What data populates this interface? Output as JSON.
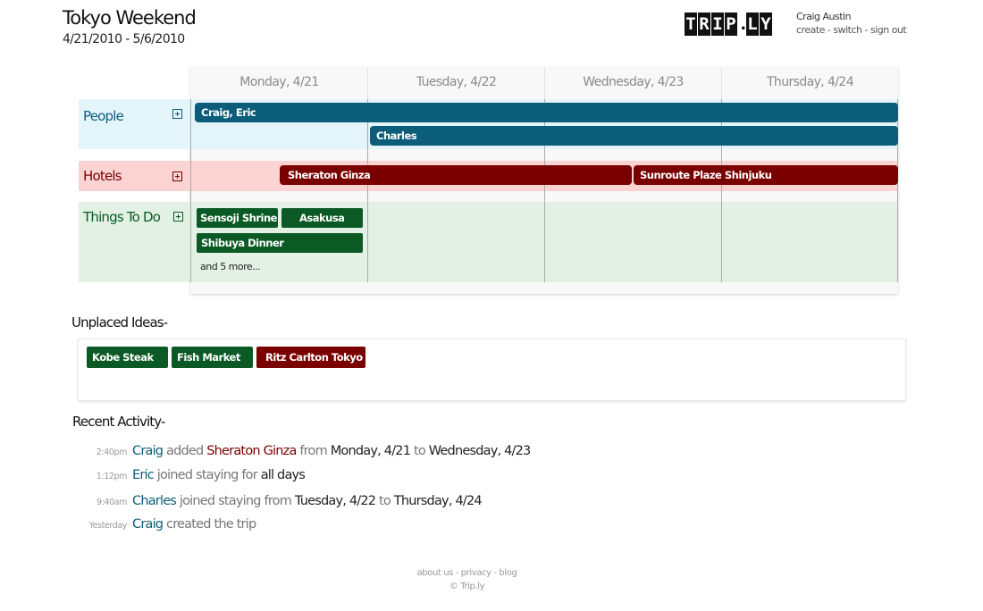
{
  "trip": {
    "title": "Tokyo Weekend",
    "dates": "4/21/2010 - 5/6/2010"
  },
  "brand": {
    "logo_letters": [
      "T",
      "R",
      "I",
      "P",
      ".",
      "L",
      "Y"
    ]
  },
  "user": {
    "name": "Craig Austin",
    "links": [
      "create",
      "switch",
      "sign out"
    ],
    "separator": " - "
  },
  "calendar": {
    "days": [
      "Monday, 4/21",
      "Tuesday, 4/22",
      "Wednesday, 4/23",
      "Thursday, 4/24"
    ],
    "rows": [
      {
        "label": "People",
        "items": [
          "Craig, Eric",
          "Charles"
        ]
      },
      {
        "label": "Hotels",
        "items": [
          "Sheraton Ginza",
          "Sunroute Plaze Shinjuku"
        ]
      },
      {
        "label": "Things To Do",
        "items": [
          "Sensoji Shrine",
          "Asakusa",
          "Shibuya Dinner"
        ],
        "more": "and 5 more..."
      }
    ]
  },
  "unplaced": {
    "title": "Unplaced Ideas-",
    "items": [
      "Kobe Steak",
      "Fish Market",
      "Ritz Carlton Tokyo"
    ]
  },
  "activity": {
    "title": "Recent Activity-",
    "entries": [
      {
        "time": "2:40pm",
        "parts": [
          "Craig",
          " added ",
          "Sheraton Ginza",
          " from ",
          "Monday, 4/21",
          " to ",
          "Wednesday, 4/23"
        ]
      },
      {
        "time": "1:12pm",
        "parts": [
          "Eric",
          " joined staying for ",
          "all days"
        ]
      },
      {
        "time": "9:40am",
        "parts": [
          "Charles",
          " joined staying from ",
          "Tuesday, 4/22",
          " to ",
          "Thursday, 4/24"
        ]
      },
      {
        "time": "Yesterday",
        "parts": [
          "Craig",
          " created the trip"
        ]
      }
    ]
  },
  "footer": {
    "links": [
      "about us",
      "privacy",
      "blog"
    ],
    "separator": " - ",
    "copyright": "© Trip.ly"
  },
  "colors": {
    "people": "#0c5d7a",
    "hotels": "#7a0000",
    "things": "#0b5a25",
    "people_bg": "#e4f4fb",
    "hotels_bg": "#fbd3d3",
    "things_bg": "#e3f1e5"
  }
}
